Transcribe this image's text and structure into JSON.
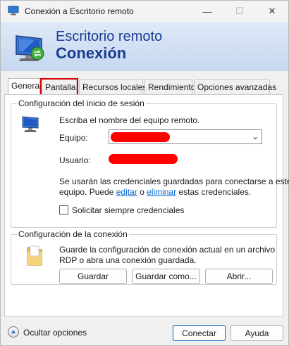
{
  "window": {
    "title": "Conexión a Escritorio remoto",
    "controls": {
      "minimize": "—",
      "maximize": "☐",
      "close": "✕"
    }
  },
  "banner": {
    "line1": "Escritorio remoto",
    "line2": "Conexión"
  },
  "tabs": [
    {
      "label": "General",
      "active": true
    },
    {
      "label": "Pantalla",
      "active": false,
      "highlighted": true
    },
    {
      "label": "Recursos locales",
      "active": false
    },
    {
      "label": "Rendimiento",
      "active": false
    },
    {
      "label": "Opciones avanzadas",
      "active": false
    }
  ],
  "logon_group": {
    "title": "Configuración del inicio de sesión",
    "instruction": "Escriba el nombre del equipo remoto.",
    "computer_label": "Equipo:",
    "computer_value": "",
    "user_label": "Usuario:",
    "user_value": "",
    "cred_text_1": "Se usarán las credenciales guardadas para conectarse a este",
    "cred_text_2_prefix": "equipo.  Puede ",
    "edit_link": "editar",
    "cred_text_or": " o ",
    "delete_link": "eliminar",
    "cred_text_suffix": " estas credenciales.",
    "always_ask_label": "Solicitar siempre credenciales",
    "always_ask_checked": false
  },
  "connection_group": {
    "title": "Configuración de la conexión",
    "description_1": "Guarde la configuración de conexión actual en un archivo",
    "description_2": "RDP o abra una conexión guardada.",
    "save_button": "Guardar",
    "save_as_button": "Guardar como...",
    "open_button": "Abrir..."
  },
  "footer": {
    "hide_options": "Ocultar opciones",
    "connect_button": "Conectar",
    "help_button": "Ayuda"
  },
  "colors": {
    "banner_text": "#1a3d8f",
    "redaction": "#ff0000",
    "highlight": "#e00000",
    "link": "#0066cc"
  }
}
